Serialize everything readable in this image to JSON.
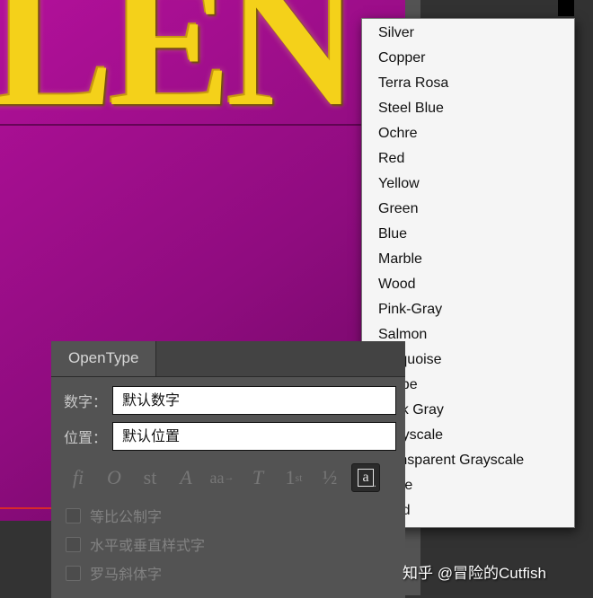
{
  "canvas": {
    "text": "LEN"
  },
  "header": {
    "swatches": [
      "black",
      "white"
    ]
  },
  "dropdown_items": [
    "Silver",
    "Copper",
    "Terra Rosa",
    "Steel Blue",
    "Ochre",
    "Red",
    "Yellow",
    "Green",
    "Blue",
    "Marble",
    "Wood",
    "Pink-Gray",
    "Salmon",
    "Turquoise",
    "Taupe",
    "Dark Gray",
    "Grayscale",
    "Transparent Grayscale",
    "Inline",
    "Solid"
  ],
  "opentype": {
    "tab": "OpenType",
    "rows": {
      "number": {
        "label": "数字：",
        "value": "默认数字"
      },
      "position": {
        "label": "位置：",
        "value": "默认位置"
      }
    },
    "icons": {
      "ligature": "fi",
      "swash": "O",
      "stylistic": "st",
      "titling": "A",
      "contextual": "aa",
      "smallcaps": "T",
      "ordinals": "1",
      "ordinals_suffix": "st",
      "fractions": "½",
      "boxed": "a"
    },
    "checks": {
      "proportional": "等比公制字",
      "hv_alternates": "水平或垂直样式字",
      "roman_italics": "罗马斜体字"
    }
  },
  "watermark": {
    "prefix": "知乎",
    "at": "@",
    "author": "冒险的Cutfish"
  }
}
